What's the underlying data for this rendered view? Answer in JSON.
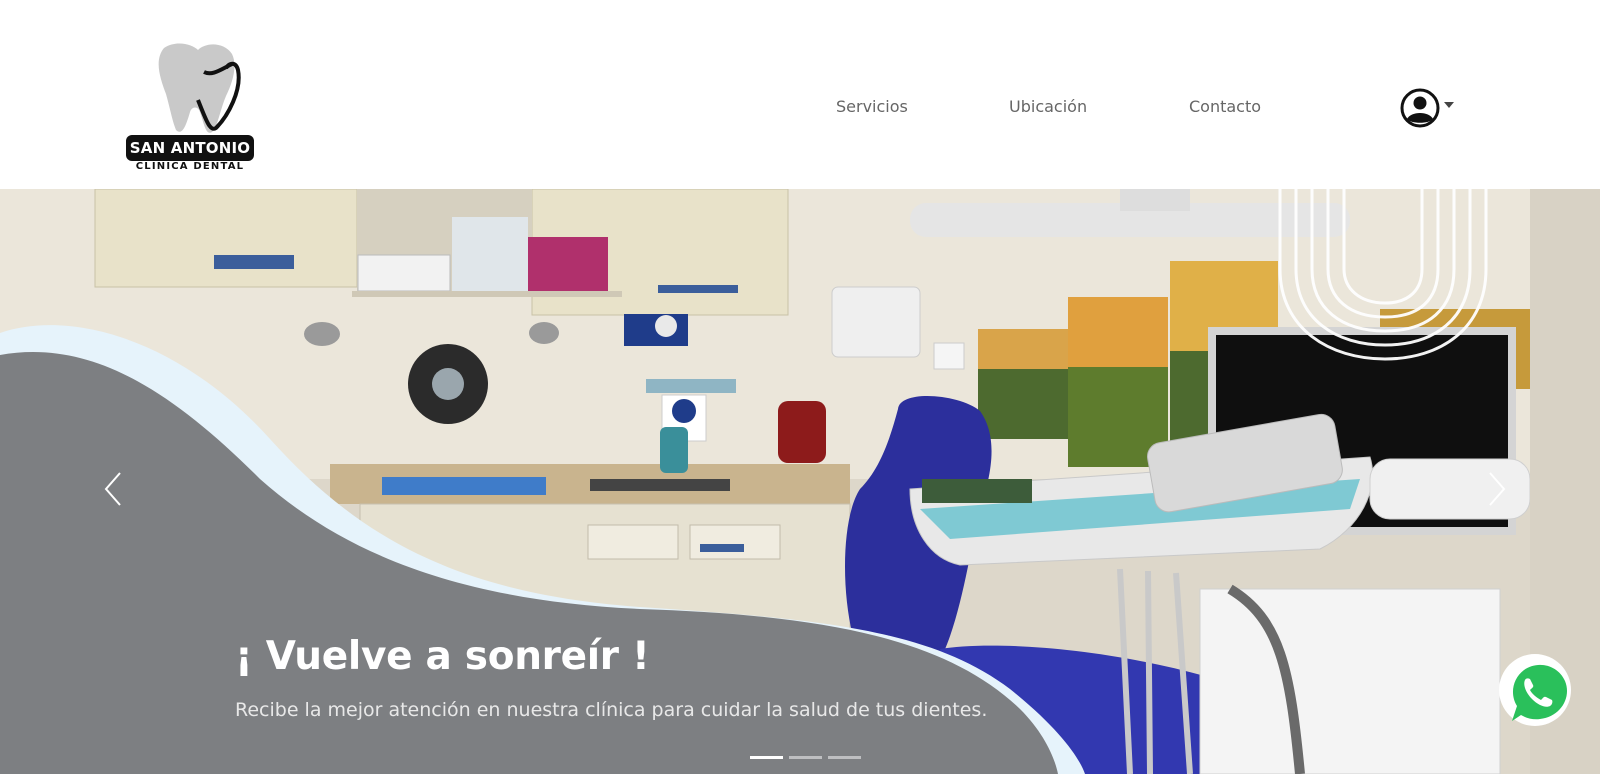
{
  "brand": {
    "name": "SAN ANTONIO",
    "tagline": "CLINICA DENTAL"
  },
  "nav": {
    "items": [
      {
        "label": "Servicios"
      },
      {
        "label": "Ubicación"
      },
      {
        "label": "Contacto"
      }
    ],
    "user_icon": "user-circle-icon"
  },
  "hero": {
    "title": "¡ Vuelve a sonreír !",
    "subtitle": "Recibe la mejor atención en nuestra clínica para cuidar la salud de tus dientes.",
    "slides_count": 3,
    "active_slide": 1
  },
  "colors": {
    "overlay_gray": "#7d7f82",
    "wave_light": "#e6f3fb",
    "chair_blue": "#2c2f9c"
  },
  "floating": {
    "whatsapp_icon": "whatsapp-icon"
  }
}
